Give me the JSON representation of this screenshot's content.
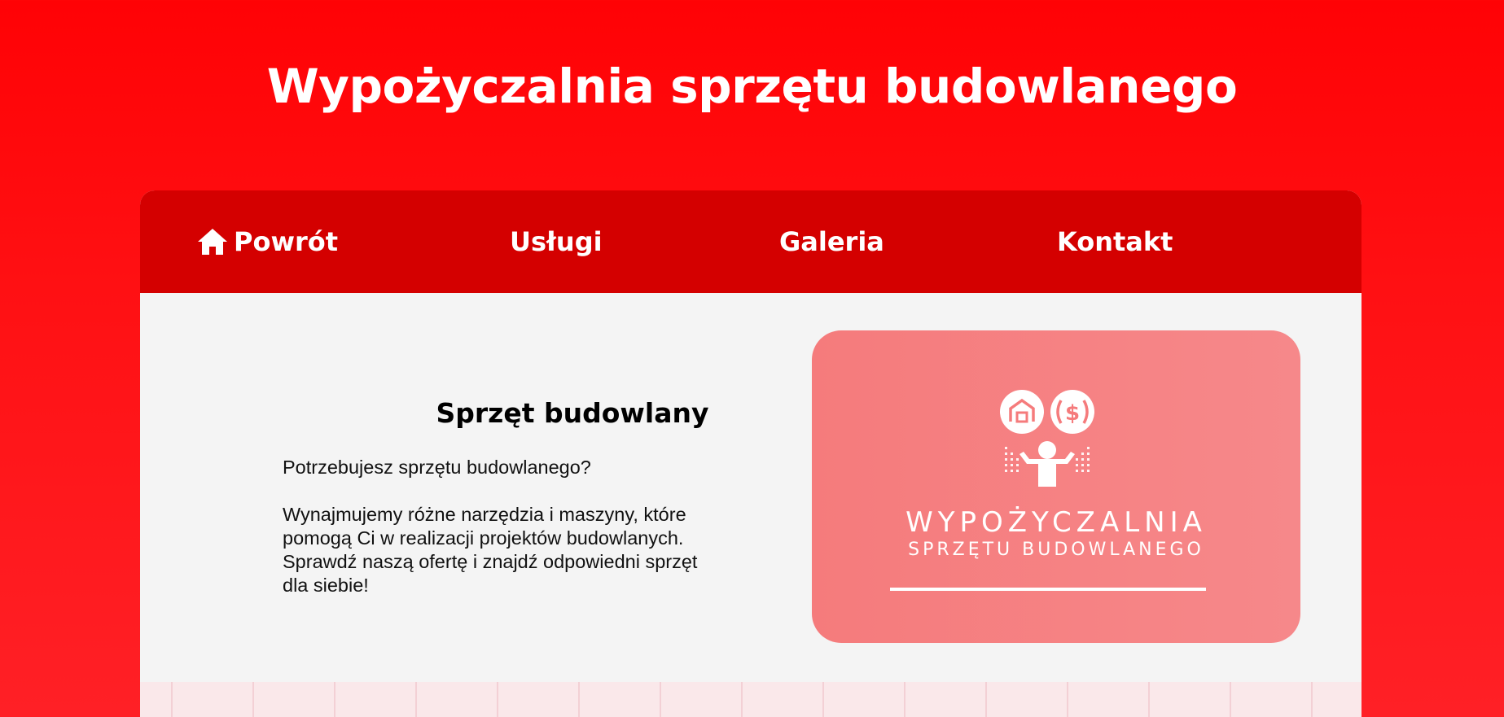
{
  "header": {
    "title": "Wypożyczalnia sprzętu budowlanego"
  },
  "nav": {
    "items": [
      {
        "label": "Powrót",
        "icon": "home-icon"
      },
      {
        "label": "Usługi"
      },
      {
        "label": "Galeria"
      },
      {
        "label": "Kontakt"
      }
    ]
  },
  "main": {
    "section_title": "Sprzęt budowlany",
    "intro": "Potrzebujesz sprzętu budowlanego?",
    "description": "Wynajmujemy różne narzędzia i maszyny, które pomogą Ci w realizacji projektów budowlanych. Sprawdź naszą ofertę i znajdź odpowiedni sprzęt dla siebie!"
  },
  "promo_logo": {
    "line1": "WYPOŻYCZALNIA",
    "line2": "SPRZĘTU BUDOWLANEGO",
    "icons": [
      "house-icon",
      "dollar-icon",
      "person-icon"
    ]
  },
  "colors": {
    "background": "#ff0a0d",
    "nav_background": "#d40000",
    "content_background": "#f4f4f4",
    "promo_background": "#f57b7c",
    "text_light": "#ffffff",
    "text_dark": "#000000"
  }
}
